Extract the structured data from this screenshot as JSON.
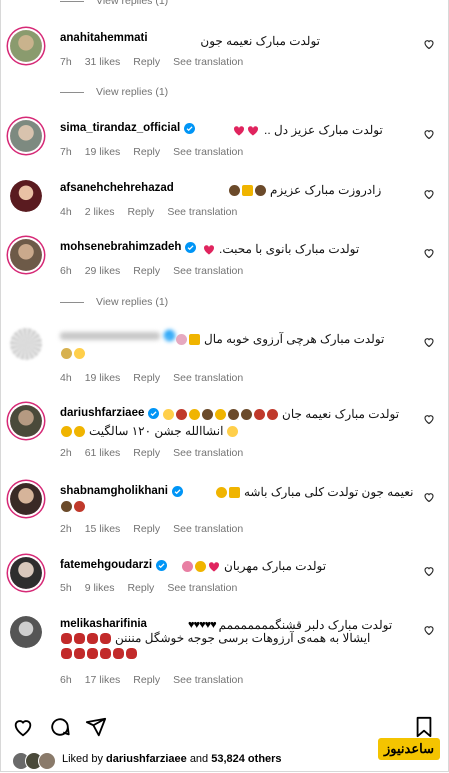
{
  "labels": {
    "view_replies": "View replies (1)",
    "reply": "Reply",
    "see_translation": "See translation"
  },
  "comments": [
    {
      "username": "anahitahemmati",
      "verified": false,
      "text": "تولدت مبارک نعیمه جون",
      "time": "7h",
      "likes": "31 likes",
      "avatar": "#8a9b6e"
    },
    {
      "username": "sima_tirandaz_official",
      "verified": true,
      "text": "تولدت مبارک عزیز دل ..",
      "time": "7h",
      "likes": "19 likes",
      "avatar": "#7d8a80"
    },
    {
      "username": "afsanehchehrehazad",
      "verified": false,
      "text": "زادروزت مبارک عزیزم",
      "time": "4h",
      "likes": "2 likes",
      "avatar": "#5a1b20"
    },
    {
      "username": "mohsenebrahimzadeh",
      "verified": true,
      "text": "تولدت مبارک بانوی با محبت.",
      "time": "6h",
      "likes": "29 likes",
      "avatar": "#6d5a48"
    },
    {
      "username": "",
      "verified": true,
      "text": "تولدت مبارک هرچی آرزوی خوبه مال",
      "time": "4h",
      "likes": "19 likes",
      "avatar": "#d0d0d0"
    },
    {
      "username": "dariushfarziaee",
      "verified": true,
      "text": "تولدت مبارک نعیمه جان",
      "text2": "انشاالله جشن ۱۲۰ سالگیت",
      "time": "2h",
      "likes": "61 likes",
      "avatar": "#4a4a3a"
    },
    {
      "username": "shabnamgholikhani",
      "verified": true,
      "text": "نعیمه جون تولدت کلی مبارک باشه",
      "time": "2h",
      "likes": "15 likes",
      "avatar": "#3a2a26"
    },
    {
      "username": "fatemehgoudarzi",
      "verified": true,
      "text": "تولدت مبارک مهربان",
      "time": "5h",
      "likes": "9 likes",
      "avatar": "#2e2e2e"
    },
    {
      "username": "melikasharifinia",
      "verified": false,
      "text": "تولدت مبارک دلبر قشنگمممممممم",
      "text2": "ایشالا به همه‌ی آرزوهات برسی جوجه خوشگل منننن",
      "time": "6h",
      "likes": "17 likes",
      "avatar": "#555555"
    }
  ],
  "footer": {
    "liked_by_prefix": "Liked by",
    "liked_user": "dariushfarziaee",
    "and": "and",
    "others": "53,824 others"
  },
  "watermark": "ساعدنیوز",
  "colors": {
    "secondary": "#737373",
    "verified": "#0095f6",
    "heart_red": "#e0245e",
    "ring": "#d62976"
  }
}
